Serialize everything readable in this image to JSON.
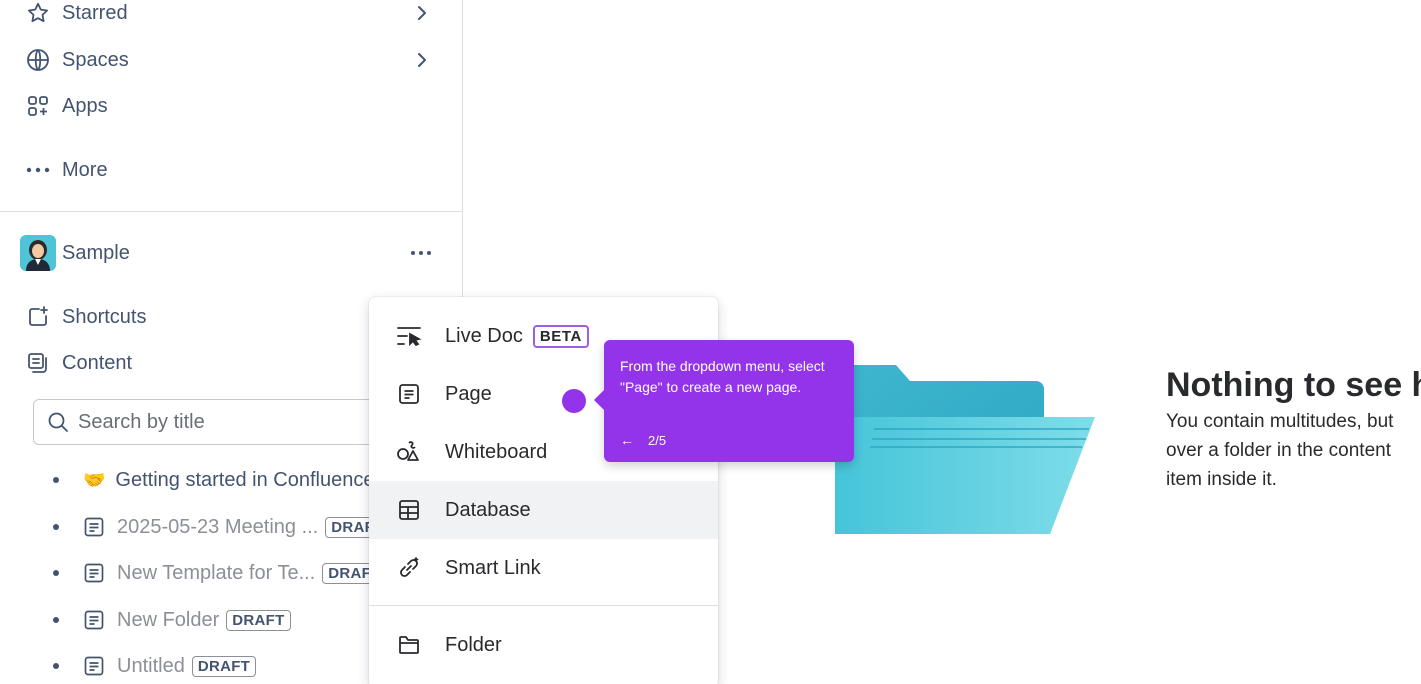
{
  "sidebar": {
    "nav": [
      {
        "label": "Starred",
        "icon": "star-icon",
        "has_chevron": true
      },
      {
        "label": "Spaces",
        "icon": "globe-icon",
        "has_chevron": true
      },
      {
        "label": "Apps",
        "icon": "apps-icon",
        "has_chevron": false
      },
      {
        "label": "More",
        "icon": "more-dots-icon",
        "has_chevron": false
      }
    ],
    "space": {
      "name": "Sample",
      "more_label": "•••"
    },
    "sections": [
      {
        "label": "Shortcuts",
        "icon": "shortcuts-icon"
      },
      {
        "label": "Content",
        "icon": "content-icon"
      }
    ],
    "search": {
      "placeholder": "Search by title"
    },
    "tree": [
      {
        "emoji": "🤝",
        "title": "Getting started in Confluence",
        "draft": ""
      },
      {
        "title": "2025-05-23 Meeting ...",
        "draft": "DRAFT"
      },
      {
        "title": "New Template for Te...",
        "draft": "DRAFT"
      },
      {
        "title": "New Folder",
        "draft": "DRAFT"
      },
      {
        "title": "Untitled",
        "draft": "DRAFT"
      }
    ]
  },
  "dropdown": {
    "items": [
      {
        "label": "Live Doc",
        "badge": "BETA",
        "icon": "live-doc-icon"
      },
      {
        "label": "Page",
        "icon": "page-icon"
      },
      {
        "label": "Whiteboard",
        "icon": "whiteboard-icon"
      },
      {
        "label": "Database",
        "icon": "database-icon"
      },
      {
        "label": "Smart Link",
        "icon": "smart-link-icon"
      },
      {
        "label": "Folder",
        "icon": "folder-icon"
      }
    ]
  },
  "tooltip": {
    "text": "From the dropdown menu, select \"Page\" to create a new page.",
    "back": "←",
    "step": "2/5"
  },
  "empty_state": {
    "title": "Nothing to see here",
    "lines": [
      "You contain multitudes, but",
      "over a folder in the content",
      "item inside it."
    ]
  },
  "colors": {
    "accent": "#9333ea",
    "beta_border": "#9c5fe0",
    "folder": "#4cc9dc"
  }
}
